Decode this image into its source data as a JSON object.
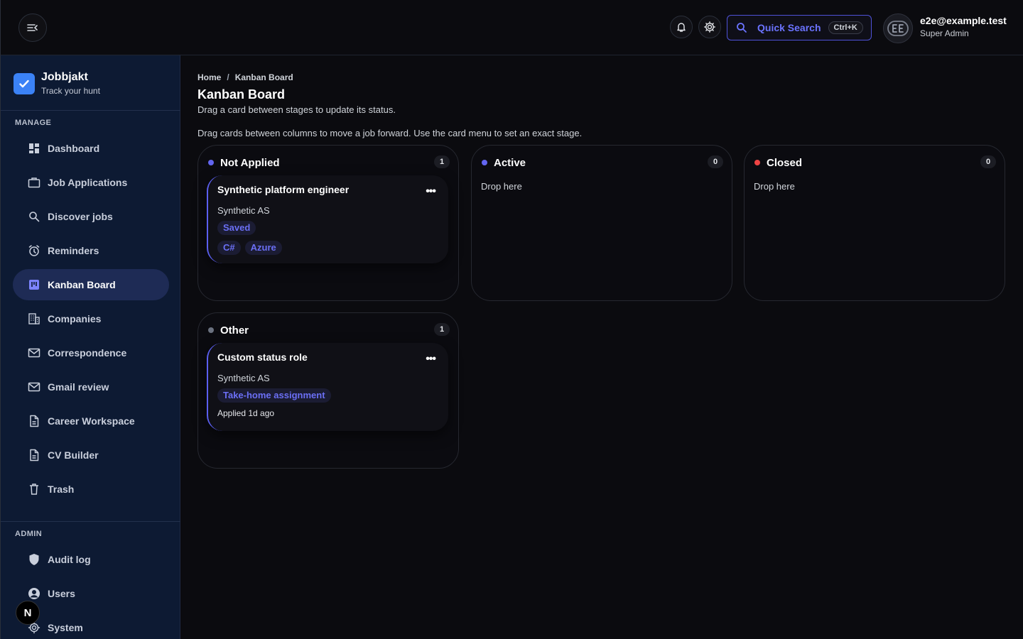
{
  "header": {
    "quick_search_label": "Quick Search",
    "quick_search_kbd": "Ctrl+K",
    "user_email": "e2e@example.test",
    "user_role": "Super Admin",
    "avatar_initials": "EE"
  },
  "brand": {
    "name": "Jobbjakt",
    "tagline": "Track your hunt"
  },
  "sidebar": {
    "manage_label": "MANAGE",
    "admin_label": "ADMIN",
    "items": [
      {
        "label": "Dashboard",
        "icon": "dashboard-icon"
      },
      {
        "label": "Job Applications",
        "icon": "briefcase-icon"
      },
      {
        "label": "Discover jobs",
        "icon": "search-icon"
      },
      {
        "label": "Reminders",
        "icon": "alarm-icon"
      },
      {
        "label": "Kanban Board",
        "icon": "kanban-icon",
        "active": true
      },
      {
        "label": "Companies",
        "icon": "building-icon"
      },
      {
        "label": "Correspondence",
        "icon": "mail-icon"
      },
      {
        "label": "Gmail review",
        "icon": "mail-icon"
      },
      {
        "label": "Career Workspace",
        "icon": "document-icon"
      },
      {
        "label": "CV Builder",
        "icon": "document-icon"
      },
      {
        "label": "Trash",
        "icon": "trash-icon"
      }
    ],
    "admin_items": [
      {
        "label": "Audit log",
        "icon": "shield-icon"
      },
      {
        "label": "Users",
        "icon": "user-icon"
      },
      {
        "label": "System",
        "icon": "gear-icon"
      }
    ],
    "next_badge": "N"
  },
  "page": {
    "breadcrumb_home": "Home",
    "breadcrumb_sep": "/",
    "breadcrumb_current": "Kanban Board",
    "title": "Kanban Board",
    "subtitle": "Drag a card between stages to update its status.",
    "hint": "Drag cards between columns to move a job forward. Use the card menu to set an exact stage."
  },
  "columns": [
    {
      "title": "Not Applied",
      "count": "1",
      "dot_color": "#6366f1",
      "card": {
        "title": "Synthetic platform engineer",
        "company": "Synthetic AS",
        "status": "Saved",
        "tags": [
          "C#",
          "Azure"
        ]
      }
    },
    {
      "title": "Active",
      "count": "0",
      "dot_color": "#6366f1",
      "drop_text": "Drop here"
    },
    {
      "title": "Closed",
      "count": "0",
      "dot_color": "#ef4444",
      "drop_text": "Drop here"
    },
    {
      "title": "Other",
      "count": "1",
      "dot_color": "#6b7280",
      "card": {
        "title": "Custom status role",
        "company": "Synthetic AS",
        "status": "Take-home assignment",
        "applied": "Applied 1d ago"
      }
    }
  ],
  "colors": {
    "accent": "#6366f1",
    "sidebar_bg": "#0d1a33",
    "closed": "#ef4444"
  }
}
